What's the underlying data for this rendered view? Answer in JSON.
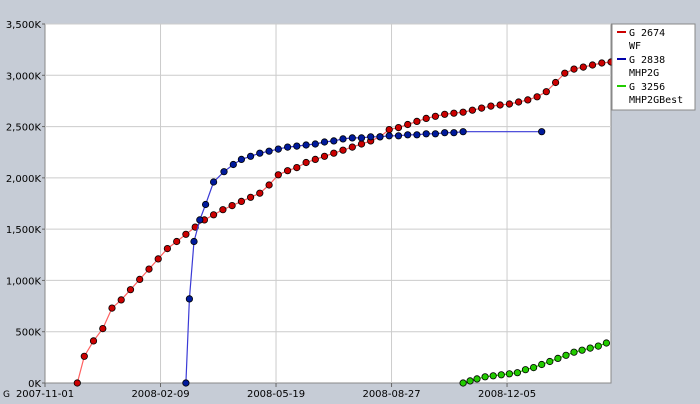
{
  "chart_data": {
    "type": "line",
    "x_tick_labels": [
      "2007-11-01",
      "2008-02-09",
      "2008-05-19",
      "2008-08-27",
      "2008-12-05"
    ],
    "x_tick_days": [
      0,
      100,
      200,
      300,
      400
    ],
    "x_range_days": [
      0,
      490
    ],
    "y_tick_labels": [
      "0K",
      "500K",
      "1,000K",
      "1,500K",
      "2,000K",
      "2,500K",
      "3,000K",
      "3,500K"
    ],
    "y_ticks": [
      0,
      500000,
      1000000,
      1500000,
      2000000,
      2500000,
      3000000,
      3500000
    ],
    "ylim": [
      0,
      3500000
    ],
    "grid": true,
    "legend_position": "top-right",
    "series": [
      {
        "name": "G 2674\nWF",
        "color": "#cc0000",
        "line_color": "#ff6060",
        "x_days": [
          28,
          34,
          42,
          50,
          58,
          66,
          74,
          82,
          90,
          98,
          106,
          114,
          122,
          130,
          138,
          146,
          154,
          162,
          170,
          178,
          186,
          194,
          202,
          210,
          218,
          226,
          234,
          242,
          250,
          258,
          266,
          274,
          282,
          290,
          298,
          306,
          314,
          322,
          330,
          338,
          346,
          354,
          362,
          370,
          378,
          386,
          394,
          402,
          410,
          418,
          426,
          434,
          442,
          450,
          458,
          466,
          474,
          482,
          490
        ],
        "y": [
          0,
          260000,
          410000,
          530000,
          730000,
          810000,
          910000,
          1010000,
          1110000,
          1210000,
          1310000,
          1380000,
          1450000,
          1520000,
          1590000,
          1640000,
          1690000,
          1730000,
          1770000,
          1810000,
          1850000,
          1930000,
          2030000,
          2070000,
          2100000,
          2150000,
          2180000,
          2210000,
          2240000,
          2270000,
          2300000,
          2330000,
          2360000,
          2400000,
          2470000,
          2490000,
          2520000,
          2550000,
          2580000,
          2600000,
          2620000,
          2630000,
          2640000,
          2660000,
          2680000,
          2700000,
          2710000,
          2720000,
          2740000,
          2760000,
          2790000,
          2840000,
          2930000,
          3020000,
          3060000,
          3080000,
          3100000,
          3120000,
          3130000
        ]
      },
      {
        "name": "G 2838\nMHP2G",
        "color": "#001a9c",
        "line_color": "#3a3ad6",
        "x_days": [
          122,
          125,
          129,
          134,
          139,
          146,
          155,
          163,
          170,
          178,
          186,
          194,
          202,
          210,
          218,
          226,
          234,
          242,
          250,
          258,
          266,
          274,
          282,
          290,
          298,
          306,
          314,
          322,
          330,
          338,
          346,
          354,
          362,
          430
        ],
        "y": [
          0,
          820000,
          1380000,
          1590000,
          1740000,
          1960000,
          2060000,
          2130000,
          2180000,
          2210000,
          2240000,
          2260000,
          2280000,
          2300000,
          2310000,
          2320000,
          2330000,
          2350000,
          2360000,
          2380000,
          2390000,
          2390000,
          2400000,
          2400000,
          2410000,
          2410000,
          2420000,
          2420000,
          2430000,
          2430000,
          2440000,
          2440000,
          2450000,
          2450000
        ]
      },
      {
        "name": "G 3256\nMHP2GBest",
        "color": "#22cc00",
        "line_color": "#33dd00",
        "x_days": [
          362,
          368,
          374,
          381,
          388,
          395,
          402,
          409,
          416,
          423,
          430,
          437,
          444,
          451,
          458,
          465,
          472,
          479,
          486
        ],
        "y": [
          0,
          20000,
          40000,
          60000,
          70000,
          80000,
          90000,
          100000,
          130000,
          150000,
          180000,
          210000,
          240000,
          270000,
          300000,
          320000,
          340000,
          360000,
          390000
        ]
      }
    ]
  },
  "legend": {
    "items": [
      {
        "line1": "G 2674",
        "line2": "WF",
        "color": "#cc0000"
      },
      {
        "line1": "G 2838",
        "line2": "MHP2G",
        "color": "#0000aa"
      },
      {
        "line1": "G 3256",
        "line2": "MHP2GBest",
        "color": "#22cc00"
      }
    ]
  },
  "corner_glyph": "G"
}
